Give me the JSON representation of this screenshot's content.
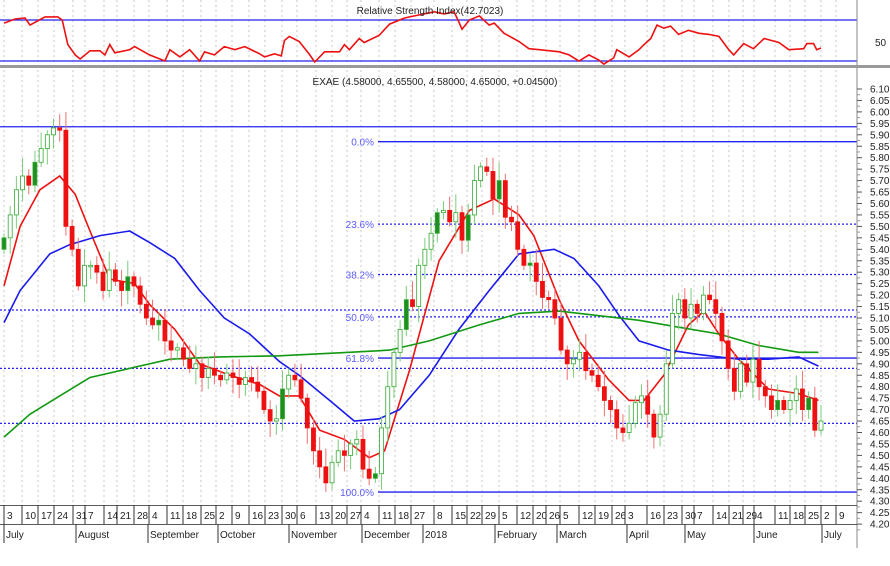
{
  "chart_data": [
    {
      "type": "line",
      "title": "Relative Strength Index(42.7023)",
      "ylim": [
        0,
        100
      ],
      "levels": [
        70,
        30
      ],
      "tick_labels": [
        "50"
      ],
      "series": [
        {
          "name": "RSI",
          "color": "#ee1111",
          "points": [
            [
              0,
              67
            ],
            [
              1.8,
              71
            ],
            [
              3.4,
              72
            ],
            [
              4.2,
              65
            ],
            [
              6.6,
              73
            ],
            [
              8.7,
              73
            ],
            [
              9.4,
              70
            ],
            [
              10.3,
              46
            ],
            [
              11.5,
              36
            ],
            [
              12.3,
              32
            ],
            [
              13.9,
              40
            ],
            [
              15.5,
              40
            ],
            [
              16.3,
              36
            ],
            [
              17.1,
              46
            ],
            [
              17.9,
              38
            ],
            [
              20.3,
              41
            ],
            [
              21.1,
              44
            ],
            [
              23.5,
              36
            ],
            [
              26,
              30
            ],
            [
              26.8,
              41
            ],
            [
              28.4,
              34
            ],
            [
              30,
              41
            ],
            [
              31.6,
              30
            ],
            [
              32.4,
              39
            ],
            [
              34,
              36
            ],
            [
              35.6,
              44
            ],
            [
              37.3,
              41
            ],
            [
              38.9,
              44
            ],
            [
              41.3,
              37
            ],
            [
              42.1,
              34
            ],
            [
              43.7,
              37
            ],
            [
              44.8,
              35
            ],
            [
              45.3,
              50
            ],
            [
              46.1,
              54
            ],
            [
              47.7,
              49
            ],
            [
              49.4,
              36
            ],
            [
              50.2,
              29
            ],
            [
              51.8,
              39
            ],
            [
              54.2,
              39
            ],
            [
              55,
              46
            ],
            [
              55.8,
              41
            ],
            [
              57.4,
              52
            ],
            [
              58.2,
              48
            ],
            [
              60.6,
              55
            ],
            [
              62.3,
              66
            ],
            [
              64.7,
              72
            ],
            [
              67.1,
              75
            ],
            [
              69.5,
              78
            ],
            [
              71.1,
              76
            ],
            [
              72.7,
              78
            ],
            [
              73.5,
              68
            ],
            [
              74,
              61
            ],
            [
              75.2,
              70
            ],
            [
              76.8,
              74
            ],
            [
              78.4,
              65
            ],
            [
              79.2,
              67
            ],
            [
              80.8,
              57
            ],
            [
              83.2,
              49
            ],
            [
              84.8,
              42
            ],
            [
              86.5,
              41
            ],
            [
              89.7,
              39
            ],
            [
              91.3,
              36
            ],
            [
              92.9,
              30
            ],
            [
              94.5,
              36
            ],
            [
              96.1,
              31
            ],
            [
              96.9,
              27
            ],
            [
              98.5,
              33
            ],
            [
              99,
              41
            ],
            [
              101,
              34
            ],
            [
              102.6,
              41
            ],
            [
              103.4,
              46
            ],
            [
              104.5,
              52
            ],
            [
              105.5,
              65
            ],
            [
              106.6,
              62
            ],
            [
              107.7,
              64
            ],
            [
              109,
              56
            ],
            [
              110.6,
              60
            ],
            [
              112.3,
              57
            ],
            [
              113.9,
              56
            ],
            [
              115.5,
              54
            ],
            [
              117.1,
              41
            ],
            [
              117.9,
              36
            ],
            [
              119.5,
              47
            ],
            [
              121.1,
              42
            ],
            [
              122.8,
              52
            ],
            [
              125.2,
              48
            ],
            [
              126.8,
              41
            ],
            [
              129.2,
              42
            ],
            [
              129.7,
              47
            ],
            [
              130.8,
              47
            ],
            [
              131.3,
              41
            ],
            [
              132,
              42.7
            ]
          ]
        }
      ]
    },
    {
      "type": "candlestick",
      "title": "EXAE (4.58000, 4.65500, 4.58000, 4.65000, +0.04500)",
      "ylim": [
        4.15,
        6.12
      ],
      "y_ticks": [
        "6.10",
        "6.05",
        "6.00",
        "5.95",
        "5.90",
        "5.85",
        "5.80",
        "5.75",
        "5.70",
        "5.65",
        "5.60",
        "5.55",
        "5.50",
        "5.45",
        "5.40",
        "5.35",
        "5.30",
        "5.25",
        "5.20",
        "5.15",
        "5.10",
        "5.05",
        "5.00",
        "4.95",
        "4.90",
        "4.85",
        "4.80",
        "4.75",
        "4.70",
        "4.65",
        "4.60",
        "4.55",
        "4.50",
        "4.45",
        "4.40",
        "4.35",
        "4.30",
        "4.25",
        "4.20"
      ],
      "first_open": 5.4,
      "close": [
        5.45,
        5.55,
        5.66,
        5.72,
        5.68,
        5.78,
        5.84,
        5.9,
        5.93,
        5.92,
        5.5,
        5.4,
        5.24,
        5.33,
        5.33,
        5.3,
        5.22,
        5.31,
        5.26,
        5.22,
        5.28,
        5.24,
        5.16,
        5.1,
        5.07,
        5.09,
        5.0,
        4.96,
        4.97,
        4.92,
        4.88,
        4.9,
        4.84,
        4.88,
        4.85,
        4.83,
        4.86,
        4.84,
        4.81,
        4.84,
        4.82,
        4.78,
        4.7,
        4.65,
        4.66,
        4.79,
        4.85,
        4.83,
        4.75,
        4.62,
        4.52,
        4.45,
        4.38,
        4.47,
        4.52,
        4.5,
        4.55,
        4.57,
        4.44,
        4.4,
        4.42,
        4.62,
        4.8,
        4.95,
        5.05,
        5.18,
        5.15,
        5.33,
        5.4,
        5.47,
        5.56,
        5.57,
        5.52,
        5.56,
        5.44,
        5.55,
        5.7,
        5.76,
        5.74,
        5.62,
        5.7,
        5.54,
        5.52,
        5.4,
        5.33,
        5.34,
        5.26,
        5.19,
        5.18,
        5.1,
        4.96,
        4.9,
        4.92,
        4.95,
        4.87,
        4.85,
        4.8,
        4.74,
        4.7,
        4.62,
        4.6,
        4.64,
        4.73,
        4.76,
        4.68,
        4.58,
        4.68,
        4.9,
        5.12,
        5.18,
        5.1,
        5.16,
        5.12,
        5.2,
        5.18,
        5.12,
        5.0,
        4.88,
        4.78,
        4.9,
        4.82,
        4.92,
        4.8,
        4.76,
        4.7,
        4.74,
        4.7,
        4.74,
        4.79,
        4.7,
        4.75,
        4.61,
        4.65
      ],
      "colors": {
        "up": "#33aa33",
        "down": "#ee1111"
      },
      "moving_averages": [
        {
          "name": "MA short",
          "color": "#ee1111",
          "points": [
            [
              0,
              5.24
            ],
            [
              2.6,
              5.5
            ],
            [
              5.8,
              5.66
            ],
            [
              9,
              5.72
            ],
            [
              11.5,
              5.64
            ],
            [
              13.9,
              5.48
            ],
            [
              17.1,
              5.27
            ],
            [
              21.1,
              5.25
            ],
            [
              23.5,
              5.16
            ],
            [
              27.6,
              5.05
            ],
            [
              31.6,
              4.9
            ],
            [
              36.5,
              4.85
            ],
            [
              41.3,
              4.81
            ],
            [
              44.5,
              4.76
            ],
            [
              47.7,
              4.76
            ],
            [
              51,
              4.61
            ],
            [
              55,
              4.57
            ],
            [
              59,
              4.49
            ],
            [
              61.5,
              4.52
            ],
            [
              65.5,
              4.87
            ],
            [
              70.3,
              5.35
            ],
            [
              75.2,
              5.57
            ],
            [
              79.2,
              5.62
            ],
            [
              83.2,
              5.55
            ],
            [
              85.6,
              5.46
            ],
            [
              89.7,
              5.18
            ],
            [
              92.9,
              5.0
            ],
            [
              97.7,
              4.83
            ],
            [
              101,
              4.74
            ],
            [
              103.4,
              4.74
            ],
            [
              106.6,
              4.85
            ],
            [
              110.6,
              5.07
            ],
            [
              113.1,
              5.13
            ],
            [
              115.5,
              5.03
            ],
            [
              118.7,
              4.92
            ],
            [
              123.5,
              4.79
            ],
            [
              128.4,
              4.77
            ],
            [
              131.6,
              4.74
            ]
          ]
        },
        {
          "name": "MA medium",
          "color": "#1a1aee",
          "points": [
            [
              0,
              5.08
            ],
            [
              2.6,
              5.22
            ],
            [
              7.4,
              5.38
            ],
            [
              10.6,
              5.42
            ],
            [
              15.5,
              5.46
            ],
            [
              20.3,
              5.48
            ],
            [
              23.5,
              5.43
            ],
            [
              27.6,
              5.36
            ],
            [
              31.6,
              5.22
            ],
            [
              35.6,
              5.1
            ],
            [
              39.7,
              5.03
            ],
            [
              44.5,
              4.91
            ],
            [
              47.7,
              4.85
            ],
            [
              52.6,
              4.74
            ],
            [
              56.6,
              4.65
            ],
            [
              60.6,
              4.66
            ],
            [
              63.9,
              4.7
            ],
            [
              68.7,
              4.85
            ],
            [
              73.5,
              5.05
            ],
            [
              78.4,
              5.22
            ],
            [
              83.2,
              5.38
            ],
            [
              88.9,
              5.4
            ],
            [
              92.1,
              5.36
            ],
            [
              96.1,
              5.24
            ],
            [
              99.4,
              5.11
            ],
            [
              102.6,
              5.0
            ],
            [
              107.4,
              4.96
            ],
            [
              112.3,
              4.94
            ],
            [
              115.5,
              4.93
            ],
            [
              118.7,
              4.92
            ],
            [
              123.5,
              4.92
            ],
            [
              128.4,
              4.93
            ],
            [
              131.6,
              4.89
            ]
          ]
        },
        {
          "name": "MA long",
          "color": "#119911",
          "points": [
            [
              0,
              4.58
            ],
            [
              4.2,
              4.68
            ],
            [
              9,
              4.76
            ],
            [
              13.9,
              4.84
            ],
            [
              20.3,
              4.88
            ],
            [
              26.8,
              4.92
            ],
            [
              34.8,
              4.93
            ],
            [
              44.5,
              4.935
            ],
            [
              55.8,
              4.95
            ],
            [
              62.3,
              4.96
            ],
            [
              68.7,
              5.0
            ],
            [
              76.8,
              5.07
            ],
            [
              83.2,
              5.12
            ],
            [
              89.7,
              5.13
            ],
            [
              96.1,
              5.11
            ],
            [
              102.6,
              5.09
            ],
            [
              109,
              5.06
            ],
            [
              115.5,
              5.03
            ],
            [
              121.9,
              4.98
            ],
            [
              128.4,
              4.95
            ],
            [
              131.6,
              4.95
            ]
          ]
        }
      ],
      "horizontal_lines": [
        {
          "price": 5.935,
          "style": "solid"
        },
        {
          "price": 5.135,
          "style": "dotted"
        },
        {
          "price": 4.88,
          "style": "dotted"
        },
        {
          "price": 4.64,
          "style": "dotted"
        }
      ],
      "fibonacci": {
        "high": 5.87,
        "low": 4.34,
        "levels": [
          {
            "label": "0.0%",
            "price": 5.87,
            "style": "solid"
          },
          {
            "label": "23.6%",
            "price": 5.51,
            "style": "dotted"
          },
          {
            "label": "38.2%",
            "price": 5.29,
            "style": "dotted"
          },
          {
            "label": "50.0%",
            "price": 5.105,
            "style": "dotted"
          },
          {
            "label": "61.8%",
            "price": 4.925,
            "style": "solid"
          },
          {
            "label": "100.0%",
            "price": 4.34,
            "style": "solid"
          }
        ]
      },
      "x_axis": {
        "days": [
          "3",
          "10",
          "17",
          "24",
          "31",
          "7",
          "14",
          "21",
          "28",
          "4",
          "11",
          "18",
          "25",
          "2",
          "9",
          "16",
          "23",
          "30",
          "6",
          "13",
          "20",
          "27",
          "4",
          "11",
          "18",
          "27",
          "8",
          "15",
          "22",
          "29",
          "5",
          "12",
          "20",
          "26",
          "5",
          "12",
          "19",
          "26",
          "3",
          "16",
          "23",
          "30",
          "7",
          "14",
          "21",
          "29",
          "4",
          "11",
          "18",
          "25",
          "2",
          "9"
        ],
        "months": [
          "July",
          "August",
          "September",
          "October",
          "November",
          "December",
          "2018",
          "February",
          "March",
          "April",
          "May",
          "June",
          "July"
        ]
      }
    }
  ]
}
